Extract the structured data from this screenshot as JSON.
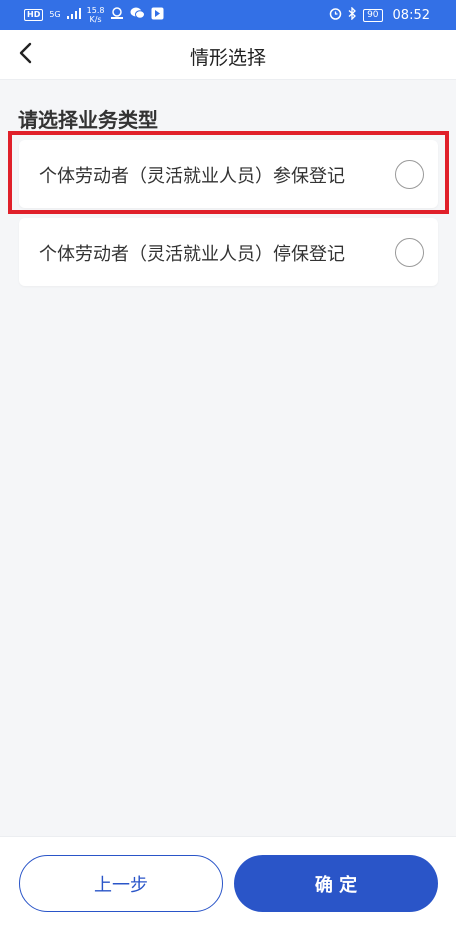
{
  "status_bar": {
    "hd_badge": "HD",
    "network": "5G",
    "speed_value": "15.8",
    "speed_unit": "K/s",
    "battery": "90",
    "time": "08:52"
  },
  "nav": {
    "title": "情形选择"
  },
  "section": {
    "title": "请选择业务类型"
  },
  "options": [
    {
      "label": "个体劳动者（灵活就业人员）参保登记",
      "selected": false
    },
    {
      "label": "个体劳动者（灵活就业人员）停保登记",
      "selected": false
    }
  ],
  "buttons": {
    "prev_label": "上一步",
    "confirm_label": "确 定"
  },
  "colors": {
    "status_bar": "#3370e6",
    "primary": "#2a55c8",
    "highlight": "#e0202a",
    "background": "#f5f6f8"
  }
}
